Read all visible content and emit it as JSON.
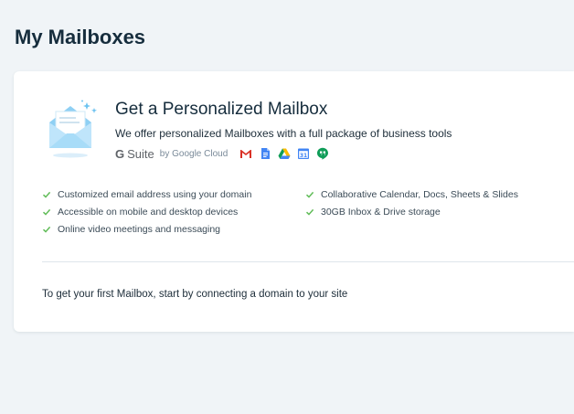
{
  "page": {
    "title": "My Mailboxes"
  },
  "card": {
    "title": "Get a Personalized Mailbox",
    "subtitle": "We offer personalized Mailboxes with a full package of business tools",
    "brand": {
      "g": "G",
      "suite": "Suite",
      "by": "by Google Cloud"
    },
    "app_icons": [
      "gmail-icon",
      "docs-icon",
      "drive-icon",
      "calendar-icon",
      "hangouts-icon"
    ],
    "calendar_day": "31",
    "features_left": [
      "Customized email address using your domain",
      "Accessible on mobile and desktop devices",
      "Online video meetings and messaging"
    ],
    "features_right": [
      "Collaborative Calendar, Docs, Sheets & Slides",
      "30GB Inbox & Drive storage"
    ],
    "footer": "To get your first Mailbox, start by connecting a domain to your site"
  },
  "colors": {
    "background": "#f0f4f7",
    "check": "#60bc57",
    "title": "#162d3d"
  }
}
